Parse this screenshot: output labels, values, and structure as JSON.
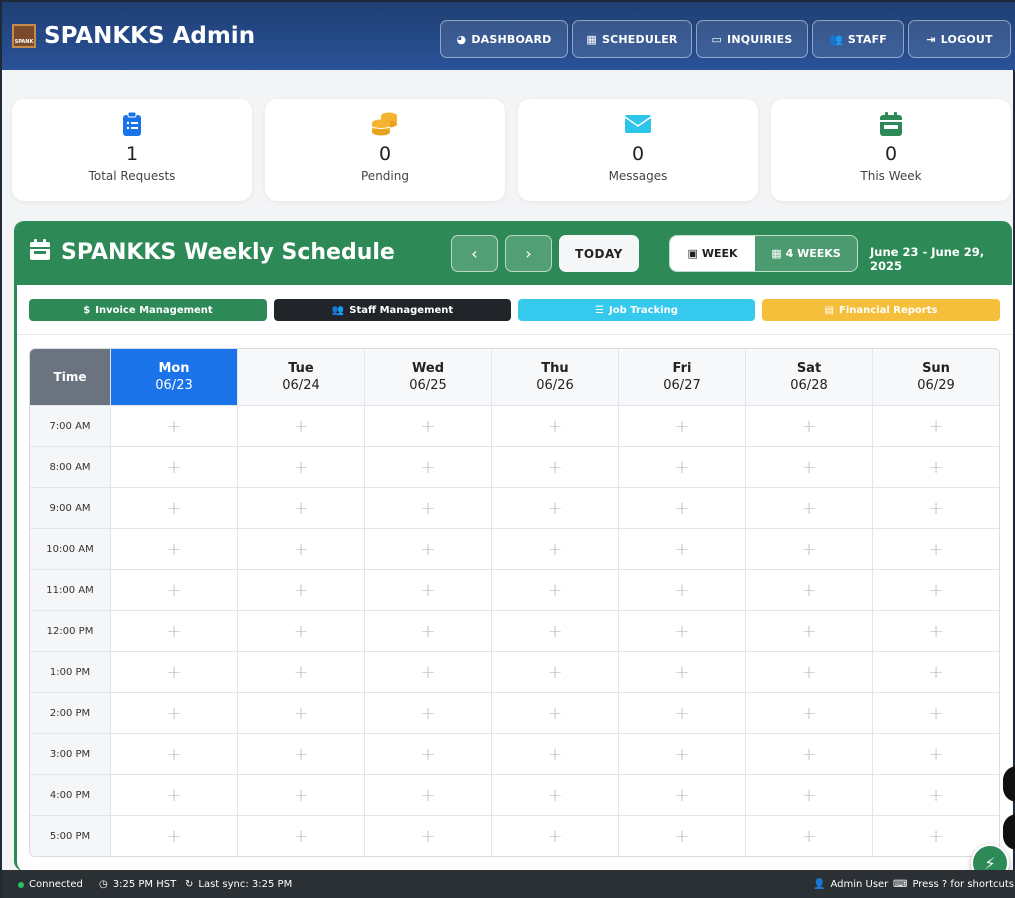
{
  "header": {
    "title": "SPANKKS Admin",
    "logo_text": "SPANK",
    "nav": [
      {
        "label": "DASHBOARD",
        "icon": "gauge-icon",
        "glyph": "◕"
      },
      {
        "label": "SCHEDULER",
        "icon": "calendar-icon",
        "glyph": "▦"
      },
      {
        "label": "INQUIRIES",
        "icon": "inbox-icon",
        "glyph": "▭"
      },
      {
        "label": "STAFF",
        "icon": "users-icon",
        "glyph": "👥"
      },
      {
        "label": "LOGOUT",
        "icon": "sign-out-icon",
        "glyph": "⇥"
      }
    ]
  },
  "stats": [
    {
      "value": "1",
      "label": "Total Requests",
      "icon": "clipboard-list-icon",
      "color": "#1a73e8"
    },
    {
      "value": "0",
      "label": "Pending",
      "icon": "coins-icon",
      "color": "#f4b42f"
    },
    {
      "value": "0",
      "label": "Messages",
      "icon": "envelope-icon",
      "color": "#2dc6ea"
    },
    {
      "value": "0",
      "label": "This Week",
      "icon": "calendar-week-icon",
      "color": "#2d8a57"
    }
  ],
  "schedule": {
    "title": "SPANKKS Weekly Schedule",
    "today_label": "TODAY",
    "week_label": "WEEK",
    "four_weeks_label": "4 WEEKS",
    "range": "June 23 - June 29, 2025",
    "quick_links": [
      {
        "label": "Invoice Management",
        "color": "#2d8a57",
        "glyph": "$"
      },
      {
        "label": "Staff Management",
        "color": "#212529",
        "glyph": "👥"
      },
      {
        "label": "Job Tracking",
        "color": "#36c9ee",
        "glyph": "☰"
      },
      {
        "label": "Financial Reports",
        "color": "#f6bf3b",
        "glyph": "▤"
      }
    ],
    "time_header": "Time",
    "days": [
      {
        "name": "Mon",
        "date": "06/23",
        "active": true
      },
      {
        "name": "Tue",
        "date": "06/24",
        "active": false
      },
      {
        "name": "Wed",
        "date": "06/25",
        "active": false
      },
      {
        "name": "Thu",
        "date": "06/26",
        "active": false
      },
      {
        "name": "Fri",
        "date": "06/27",
        "active": false
      },
      {
        "name": "Sat",
        "date": "06/28",
        "active": false
      },
      {
        "name": "Sun",
        "date": "06/29",
        "active": false
      }
    ],
    "times": [
      "7:00 AM",
      "8:00 AM",
      "9:00 AM",
      "10:00 AM",
      "11:00 AM",
      "12:00 PM",
      "1:00 PM",
      "2:00 PM",
      "3:00 PM",
      "4:00 PM",
      "5:00 PM"
    ],
    "add_glyph": "+"
  },
  "footer": {
    "status": "Connected",
    "time": "3:25 PM HST",
    "sync": "Last sync: 3:25 PM",
    "user": "Admin User",
    "shortcuts": "Press ? for shortcuts"
  },
  "colors": {
    "brand_green": "#2d8a57",
    "active_day": "#1a73e8",
    "header_blue": "#2a5298"
  }
}
